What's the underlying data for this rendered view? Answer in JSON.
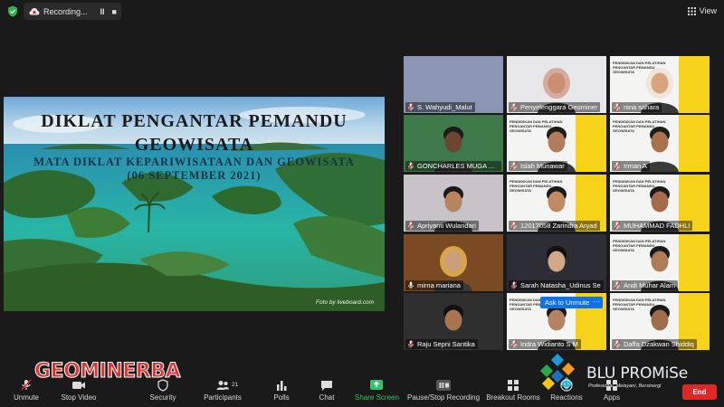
{
  "topbar": {
    "recording_label": "Recording...",
    "pause_glyph": "II",
    "stop_glyph": "■",
    "view_label": "View",
    "icons": [
      "shield-icon",
      "cloud-record-icon",
      "grid-view-icon"
    ]
  },
  "slide": {
    "title_line1": "DIKLAT PENGANTAR PEMANDU",
    "title_line2": "GEOWISATA",
    "subtitle_line1": "MATA DIKLAT KEPARIWISATAAN DAN GEOWISATA",
    "subtitle_line2": "(06 SEPTEMBER 2021)",
    "photo_credit": "Foto by liveboard.com"
  },
  "participants": [
    {
      "name": "S. Wahyudi_Malut",
      "muted": true
    },
    {
      "name": "Penyelenggara Geominer",
      "muted": true
    },
    {
      "name": "nina sahara",
      "muted": true
    },
    {
      "name": "GONCHARLES MUGA MEO",
      "muted": true
    },
    {
      "name": "Islah Munawar",
      "muted": true
    },
    {
      "name": "Irman A",
      "muted": true
    },
    {
      "name": "Apriyanti Wulandari",
      "muted": true
    },
    {
      "name": "12017058 Zarindra Aryad",
      "muted": true
    },
    {
      "name": "MUHAMMAD FADHLI",
      "muted": true
    },
    {
      "name": "mirna mariana",
      "muted": false,
      "active_speaker": true
    },
    {
      "name": "Sarah Natasha_Udinus Se",
      "muted": true
    },
    {
      "name": "Andi Muhar Alam",
      "muted": true
    },
    {
      "name": "Raju Sepni Santika",
      "muted": true
    },
    {
      "name": "Indra Widianto S M",
      "muted": true
    },
    {
      "name": "Daffa Dzakwan Shiddiq",
      "muted": true
    }
  ],
  "poster": {
    "line1": "PENDIDIKAN DAN PELATIHAN",
    "line2": "PENGANTAR PEMANDU",
    "line3": "GEOWISATA"
  },
  "popup": {
    "ask_unmute": "Ask to Unmute",
    "more": "···"
  },
  "toolbar": {
    "unmute": "Unmute",
    "stop_video": "Stop Video",
    "security": "Security",
    "participants": "Participants",
    "participants_count": "21",
    "polls": "Polls",
    "chat": "Chat",
    "share_screen": "Share Screen",
    "pause_recording": "Pause/Stop Recording",
    "breakout_rooms": "Breakout Rooms",
    "reactions": "Reactions",
    "apps": "Apps",
    "end": "End"
  },
  "overlays": {
    "geominerba": "GEOMINERBA",
    "blu_promise": "BLU PROMiSe",
    "blu_tagline": "Profesional, Melayani, Bersinergi"
  },
  "colors": {
    "accent_green": "#34c36b",
    "end_red": "#e02828",
    "active_speaker": "#f0c800",
    "popup_blue": "#0e72ed",
    "poster_yellow": "#f7d21a"
  }
}
